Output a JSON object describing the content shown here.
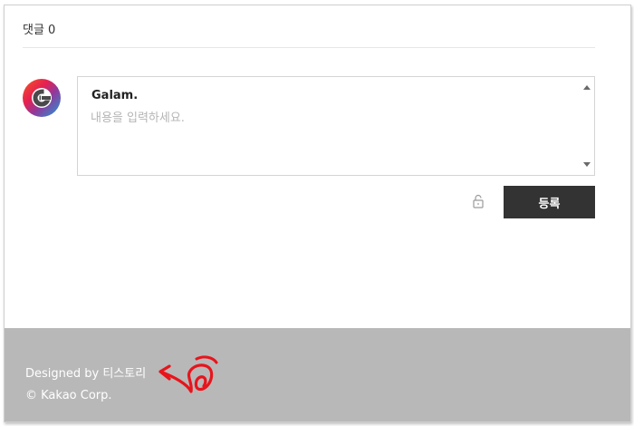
{
  "comments": {
    "header": "댓글 0",
    "author_name": "Galam.",
    "input_placeholder": "내용을 입력하세요.",
    "input_value": "",
    "submit_label": "등록"
  },
  "icons": {
    "avatar": "galam-logo-icon",
    "lock": "unlock-icon",
    "scroll_up": "scroll-up-arrow-icon",
    "scroll_down": "scroll-down-arrow-icon",
    "annotation": "red-scribble-arrow-icon"
  },
  "colors": {
    "submit_bg": "#333333",
    "footer_bg": "#b8b8b8",
    "annotation": "#e8141c"
  },
  "footer": {
    "designed_by": "Designed by 티스토리",
    "copyright": "© Kakao Corp."
  }
}
